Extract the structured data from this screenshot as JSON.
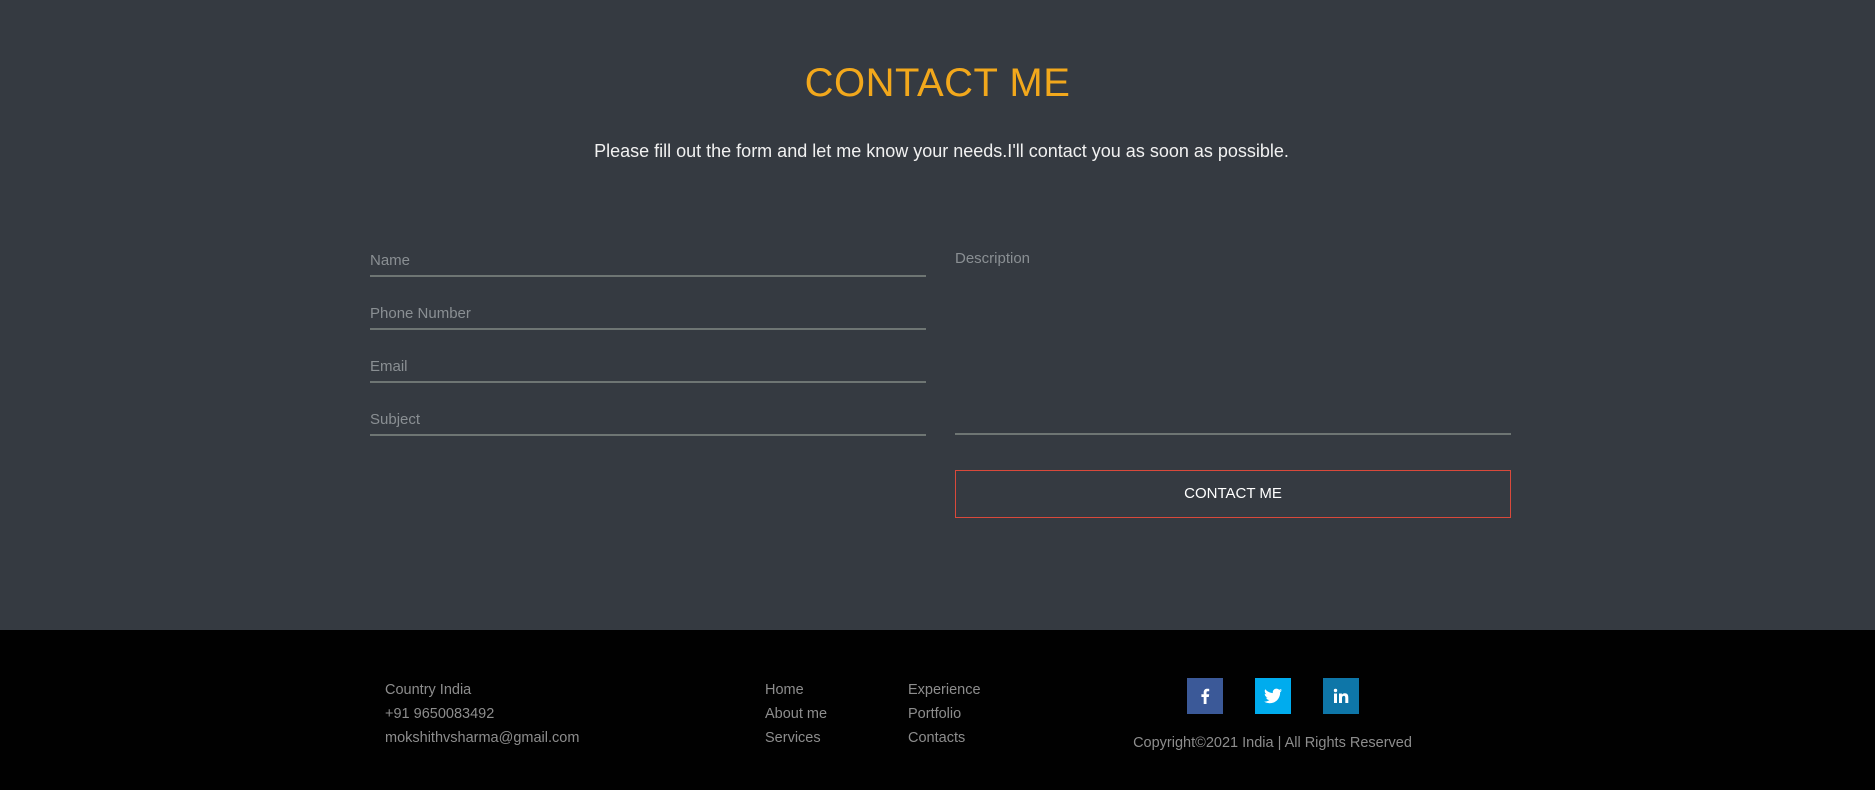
{
  "contact": {
    "title": "CONTACT ME",
    "subtitle": "Please fill out the form and let me know your needs.I'll contact you as soon as possible.",
    "form": {
      "name_placeholder": "Name",
      "phone_placeholder": "Phone Number",
      "email_placeholder": "Email",
      "subject_placeholder": "Subject",
      "description_placeholder": "Description",
      "submit_label": "CONTACT ME"
    }
  },
  "footer": {
    "contact_info": [
      "Country India",
      "+91 9650083492",
      "mokshithvsharma@gmail.com"
    ],
    "nav_col_1": [
      "Home",
      "About me",
      "Services"
    ],
    "nav_col_2": [
      "Experience",
      "Portfolio",
      "Contacts"
    ],
    "social": [
      "facebook-icon",
      "twitter-icon",
      "linkedin-icon"
    ],
    "copyright": "Copyright©2021 India | All Rights Reserved"
  },
  "colors": {
    "section_bg": "#353a41",
    "title": "#f2a81c",
    "button_border": "#d9493b",
    "footer_bg": "#010101",
    "facebook": "#3b5998",
    "twitter": "#00acee",
    "linkedin": "#0e76a8"
  }
}
